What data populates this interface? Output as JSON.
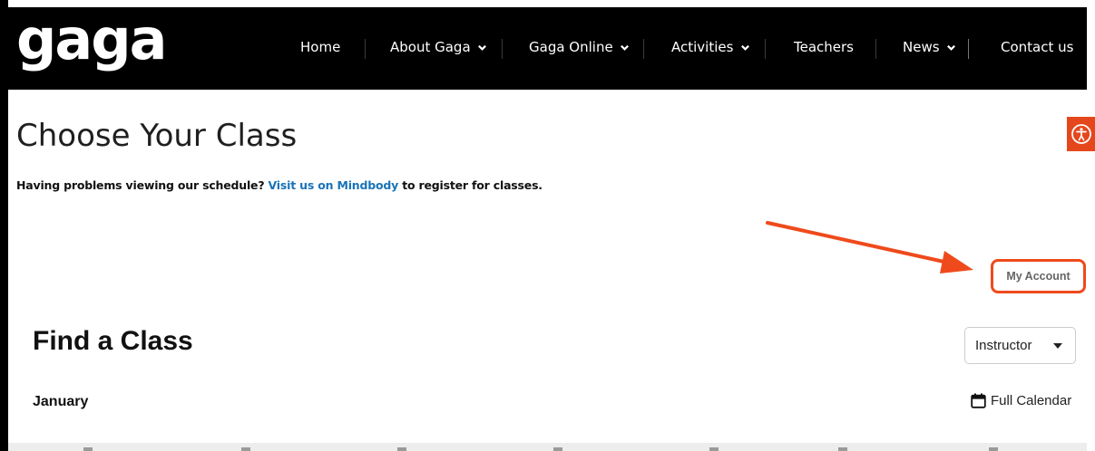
{
  "header": {
    "logo_text": "gaga",
    "nav": [
      {
        "label": "Home",
        "dropdown": false
      },
      {
        "label": "About Gaga",
        "dropdown": true
      },
      {
        "label": "Gaga Online",
        "dropdown": true
      },
      {
        "label": "Activities",
        "dropdown": true
      },
      {
        "label": "Teachers",
        "dropdown": false
      },
      {
        "label": "News",
        "dropdown": true
      },
      {
        "label": "Contact us",
        "dropdown": false
      }
    ]
  },
  "main": {
    "title": "Choose Your Class",
    "notice_prefix": "Having problems viewing our schedule?",
    "notice_link": "Visit us on Mindbody",
    "notice_suffix": "to register for classes.",
    "my_account_label": "My Account"
  },
  "widget": {
    "find_title": "Find a Class",
    "filter_label": "Instructor",
    "month": "January",
    "full_calendar_label": "Full Calendar"
  },
  "colors": {
    "nav_bg": "#000000",
    "link": "#1a73b8",
    "annotation": "#ef4a1c",
    "accessibility_btn": "#e5471c"
  },
  "icons": {
    "chevron": "chevron-down-icon",
    "accessibility": "accessibility-icon",
    "calendar": "calendar-icon",
    "arrow": "annotation-arrow"
  }
}
